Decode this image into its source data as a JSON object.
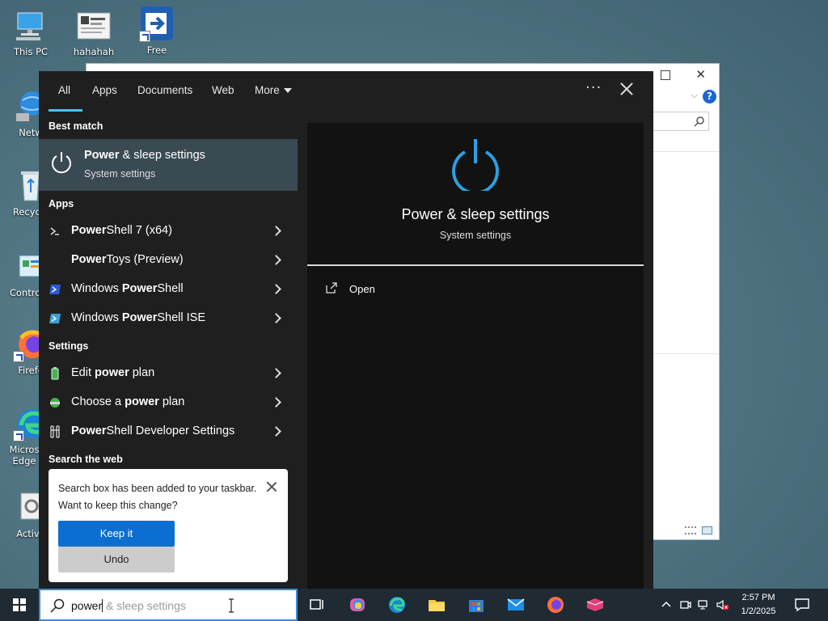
{
  "desktop": {
    "icons": [
      {
        "label": "This PC"
      },
      {
        "label": "hahahah"
      },
      {
        "label": "Free"
      },
      {
        "label": "Netw"
      },
      {
        "label": "Recycle"
      },
      {
        "label": "Control P"
      },
      {
        "label": "Firefo"
      },
      {
        "label": "Micros Edge"
      },
      {
        "label": "Activa"
      }
    ]
  },
  "search_panel": {
    "tabs": [
      "All",
      "Apps",
      "Documents",
      "Web",
      "More"
    ],
    "active_tab": "All",
    "sections": {
      "best_match": "Best match",
      "apps": "Apps",
      "settings": "Settings",
      "search_web": "Search the web"
    },
    "best_match": {
      "title_bold": "Power",
      "title_rest": " & sleep settings",
      "subtitle": "System settings"
    },
    "apps": [
      {
        "bold": "Power",
        "rest": "Shell 7 (x64)",
        "prefix": ""
      },
      {
        "bold": "Power",
        "rest": "Toys (Preview)",
        "prefix": ""
      },
      {
        "prefix": "Windows ",
        "bold": "Power",
        "rest": "Shell"
      },
      {
        "prefix": "Windows ",
        "bold": "Power",
        "rest": "Shell ISE"
      }
    ],
    "settings": [
      {
        "prefix": "Edit ",
        "bold": "power",
        "rest": " plan"
      },
      {
        "prefix": "Choose a ",
        "bold": "power",
        "rest": " plan"
      },
      {
        "prefix": "",
        "bold": "Power",
        "rest": "Shell Developer Settings"
      }
    ],
    "detail": {
      "title": "Power & sleep settings",
      "subtitle": "System settings",
      "action_open": "Open"
    },
    "accent_color": "#4cc2ff"
  },
  "toast": {
    "message": "Search box has been added to your taskbar. Want to keep this change?",
    "keep_label": "Keep it",
    "undo_label": "Undo"
  },
  "taskbar": {
    "search_typed": "power",
    "search_suggestion": " & sleep settings",
    "time": "2:57 PM",
    "date": "1/2/2025"
  }
}
